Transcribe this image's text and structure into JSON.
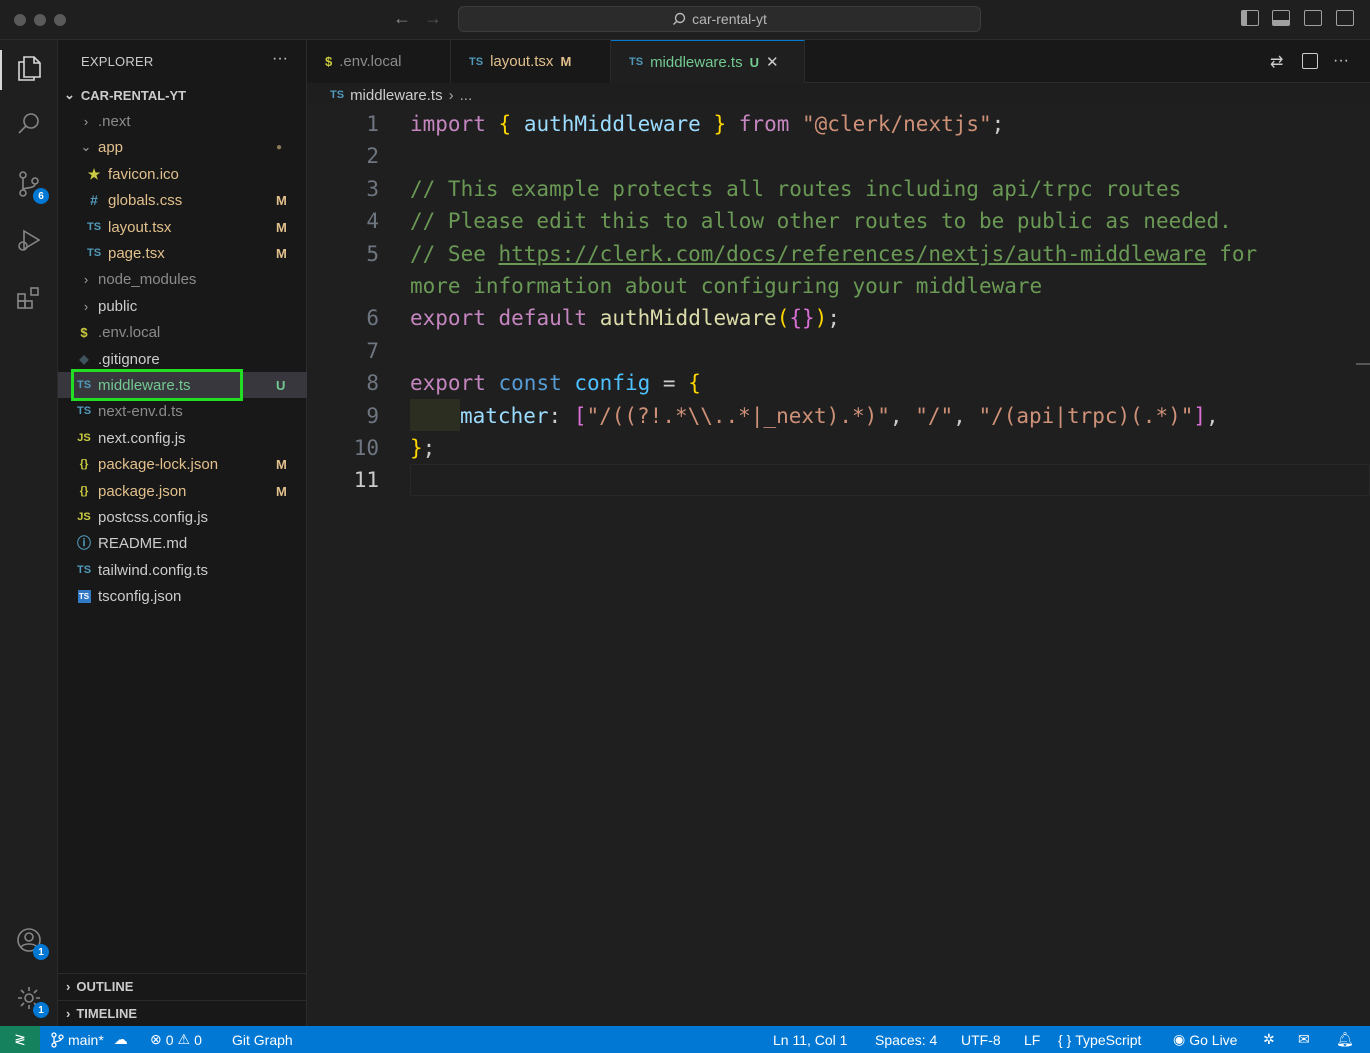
{
  "window": {
    "search_label": "car-rental-yt"
  },
  "activity": {
    "scm_badge": "6",
    "accounts_badge": "1",
    "manage_badge": "1"
  },
  "sidebar": {
    "title": "EXPLORER",
    "more": "···",
    "root": "CAR-RENTAL-YT",
    "items": [
      {
        "label": ".next",
        "chev": "›",
        "icon": "",
        "status": ""
      },
      {
        "label": "app",
        "chev": "⌄",
        "icon": "",
        "status": "●"
      },
      {
        "label": "favicon.ico",
        "chev": "",
        "icon": "★",
        "status": ""
      },
      {
        "label": "globals.css",
        "chev": "",
        "icon": "#",
        "status": "M"
      },
      {
        "label": "layout.tsx",
        "chev": "",
        "icon": "TS",
        "status": "M"
      },
      {
        "label": "page.tsx",
        "chev": "",
        "icon": "TS",
        "status": "M"
      },
      {
        "label": "node_modules",
        "chev": "›",
        "icon": "",
        "status": ""
      },
      {
        "label": "public",
        "chev": "›",
        "icon": "",
        "status": ""
      },
      {
        "label": ".env.local",
        "chev": "",
        "icon": "$",
        "status": ""
      },
      {
        "label": ".gitignore",
        "chev": "",
        "icon": "◆",
        "status": ""
      },
      {
        "label": "middleware.ts",
        "chev": "",
        "icon": "TS",
        "status": "U"
      },
      {
        "label": "next-env.d.ts",
        "chev": "",
        "icon": "TS",
        "status": ""
      },
      {
        "label": "next.config.js",
        "chev": "",
        "icon": "JS",
        "status": ""
      },
      {
        "label": "package-lock.json",
        "chev": "",
        "icon": "{}",
        "status": "M"
      },
      {
        "label": "package.json",
        "chev": "",
        "icon": "{}",
        "status": "M"
      },
      {
        "label": "postcss.config.js",
        "chev": "",
        "icon": "JS",
        "status": ""
      },
      {
        "label": "README.md",
        "chev": "",
        "icon": "ⓘ",
        "status": ""
      },
      {
        "label": "tailwind.config.ts",
        "chev": "",
        "icon": "TS",
        "status": ""
      },
      {
        "label": "tsconfig.json",
        "chev": "",
        "icon": "TS",
        "status": ""
      }
    ],
    "outline": "OUTLINE",
    "timeline": "TIMELINE"
  },
  "tabs": [
    {
      "icon": "$",
      "label": ".env.local",
      "status": ""
    },
    {
      "icon": "TS",
      "label": "layout.tsx",
      "status": "M"
    },
    {
      "icon": "TS",
      "label": "middleware.ts",
      "status": "U",
      "close": "✕"
    }
  ],
  "breadcrumb": {
    "icon": "TS",
    "file": "middleware.ts",
    "sep": "›",
    "more": "..."
  },
  "editor": {
    "line_numbers": [
      "1",
      "2",
      "3",
      "4",
      "5",
      "6",
      "7",
      "8",
      "9",
      "10",
      "11"
    ],
    "l1": {
      "import": "import",
      "ob": "{",
      "name": " authMiddleware ",
      "cb": "}",
      "from": "from",
      "src": "\"@clerk/nextjs\"",
      "semi": ";"
    },
    "l3": "// This example protects all routes including api/trpc routes",
    "l4": "// Please edit this to allow other routes to be public as needed.",
    "l5": {
      "pre": "// See ",
      "url": "https://clerk.com/docs/references/nextjs/auth-middleware",
      "post": " for"
    },
    "l5b": "more information about configuring your middleware",
    "l6": {
      "export": "export",
      "default": "default",
      "fn": "authMiddleware",
      "p1": "(",
      "ob": "{",
      "cb": "}",
      "p2": ")",
      "semi": ";"
    },
    "l8": {
      "export": "export",
      "const": "const",
      "name": "config",
      "eq": " = ",
      "ob": "{"
    },
    "l9": {
      "key": "matcher",
      "colon": ": ",
      "ob": "[",
      "s1": "\"/((?!.*\\\\..*|_next).*)\"",
      "c1": ", ",
      "s2": "\"/\"",
      "c2": ", ",
      "s3": "\"/(api|trpc)(.*)\"",
      "cb": "]",
      "comma": ","
    },
    "l10": {
      "cb": "}",
      "semi": ";"
    }
  },
  "status": {
    "remote": "≷",
    "branch": "main*",
    "errors": "0",
    "warnings": "0",
    "git_graph": "Git Graph",
    "position": "Ln 11, Col 1",
    "spaces": "Spaces: 4",
    "encoding": "UTF-8",
    "eol": "LF",
    "language": "TypeScript",
    "golive": "Go Live"
  }
}
